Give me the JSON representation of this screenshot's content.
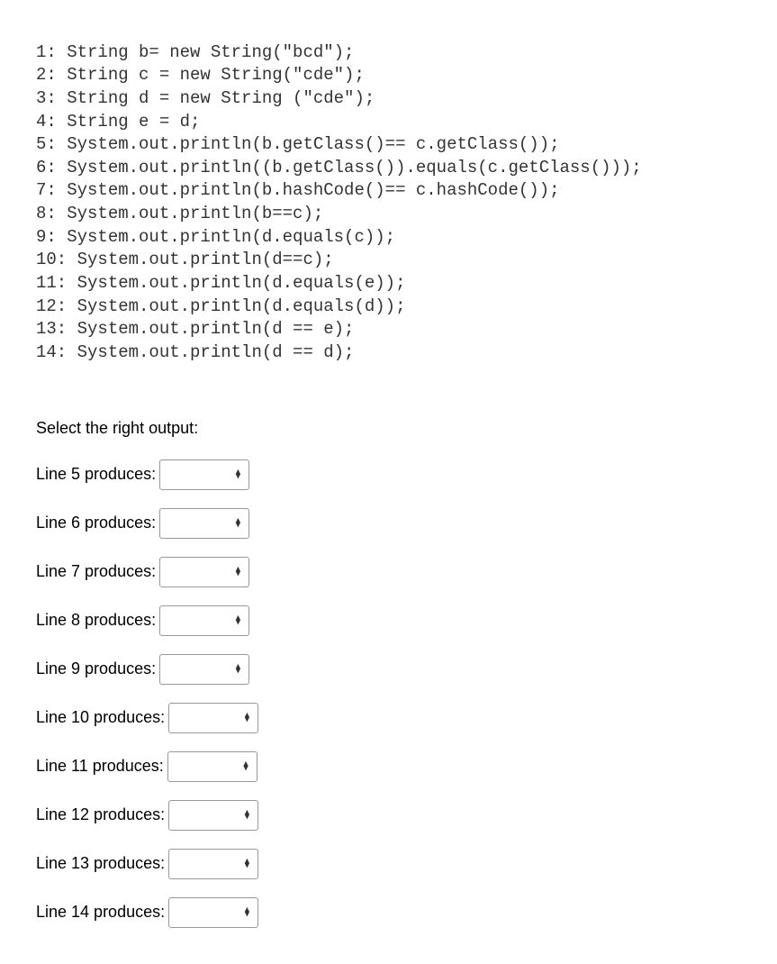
{
  "code": {
    "lines": [
      "1: String b= new String(\"bcd\");",
      "2: String c = new String(\"cde\");",
      "3: String d = new String (\"cde\");",
      "4: String e = d;",
      "5: System.out.println(b.getClass()== c.getClass());",
      "6: System.out.println((b.getClass()).equals(c.getClass()));",
      "7: System.out.println(b.hashCode()== c.hashCode());",
      "8: System.out.println(b==c);",
      "9: System.out.println(d.equals(c));",
      "10: System.out.println(d==c);",
      "11: System.out.println(d.equals(e));",
      "12: System.out.println(d.equals(d));",
      "13: System.out.println(d == e);",
      "14: System.out.println(d == d);"
    ]
  },
  "prompt": "Select the right output:",
  "questions": [
    {
      "label": "Line 5 produces:",
      "value": ""
    },
    {
      "label": "Line 6 produces:",
      "value": ""
    },
    {
      "label": "Line 7 produces:",
      "value": ""
    },
    {
      "label": "Line 8 produces:",
      "value": ""
    },
    {
      "label": "Line 9 produces:",
      "value": ""
    },
    {
      "label": "Line 10 produces:",
      "value": ""
    },
    {
      "label": "Line 11 produces:",
      "value": ""
    },
    {
      "label": "Line 12 produces:",
      "value": ""
    },
    {
      "label": "Line 13 produces:",
      "value": ""
    },
    {
      "label": "Line 14 produces:",
      "value": ""
    }
  ],
  "select_arrow": "▴\n▾"
}
